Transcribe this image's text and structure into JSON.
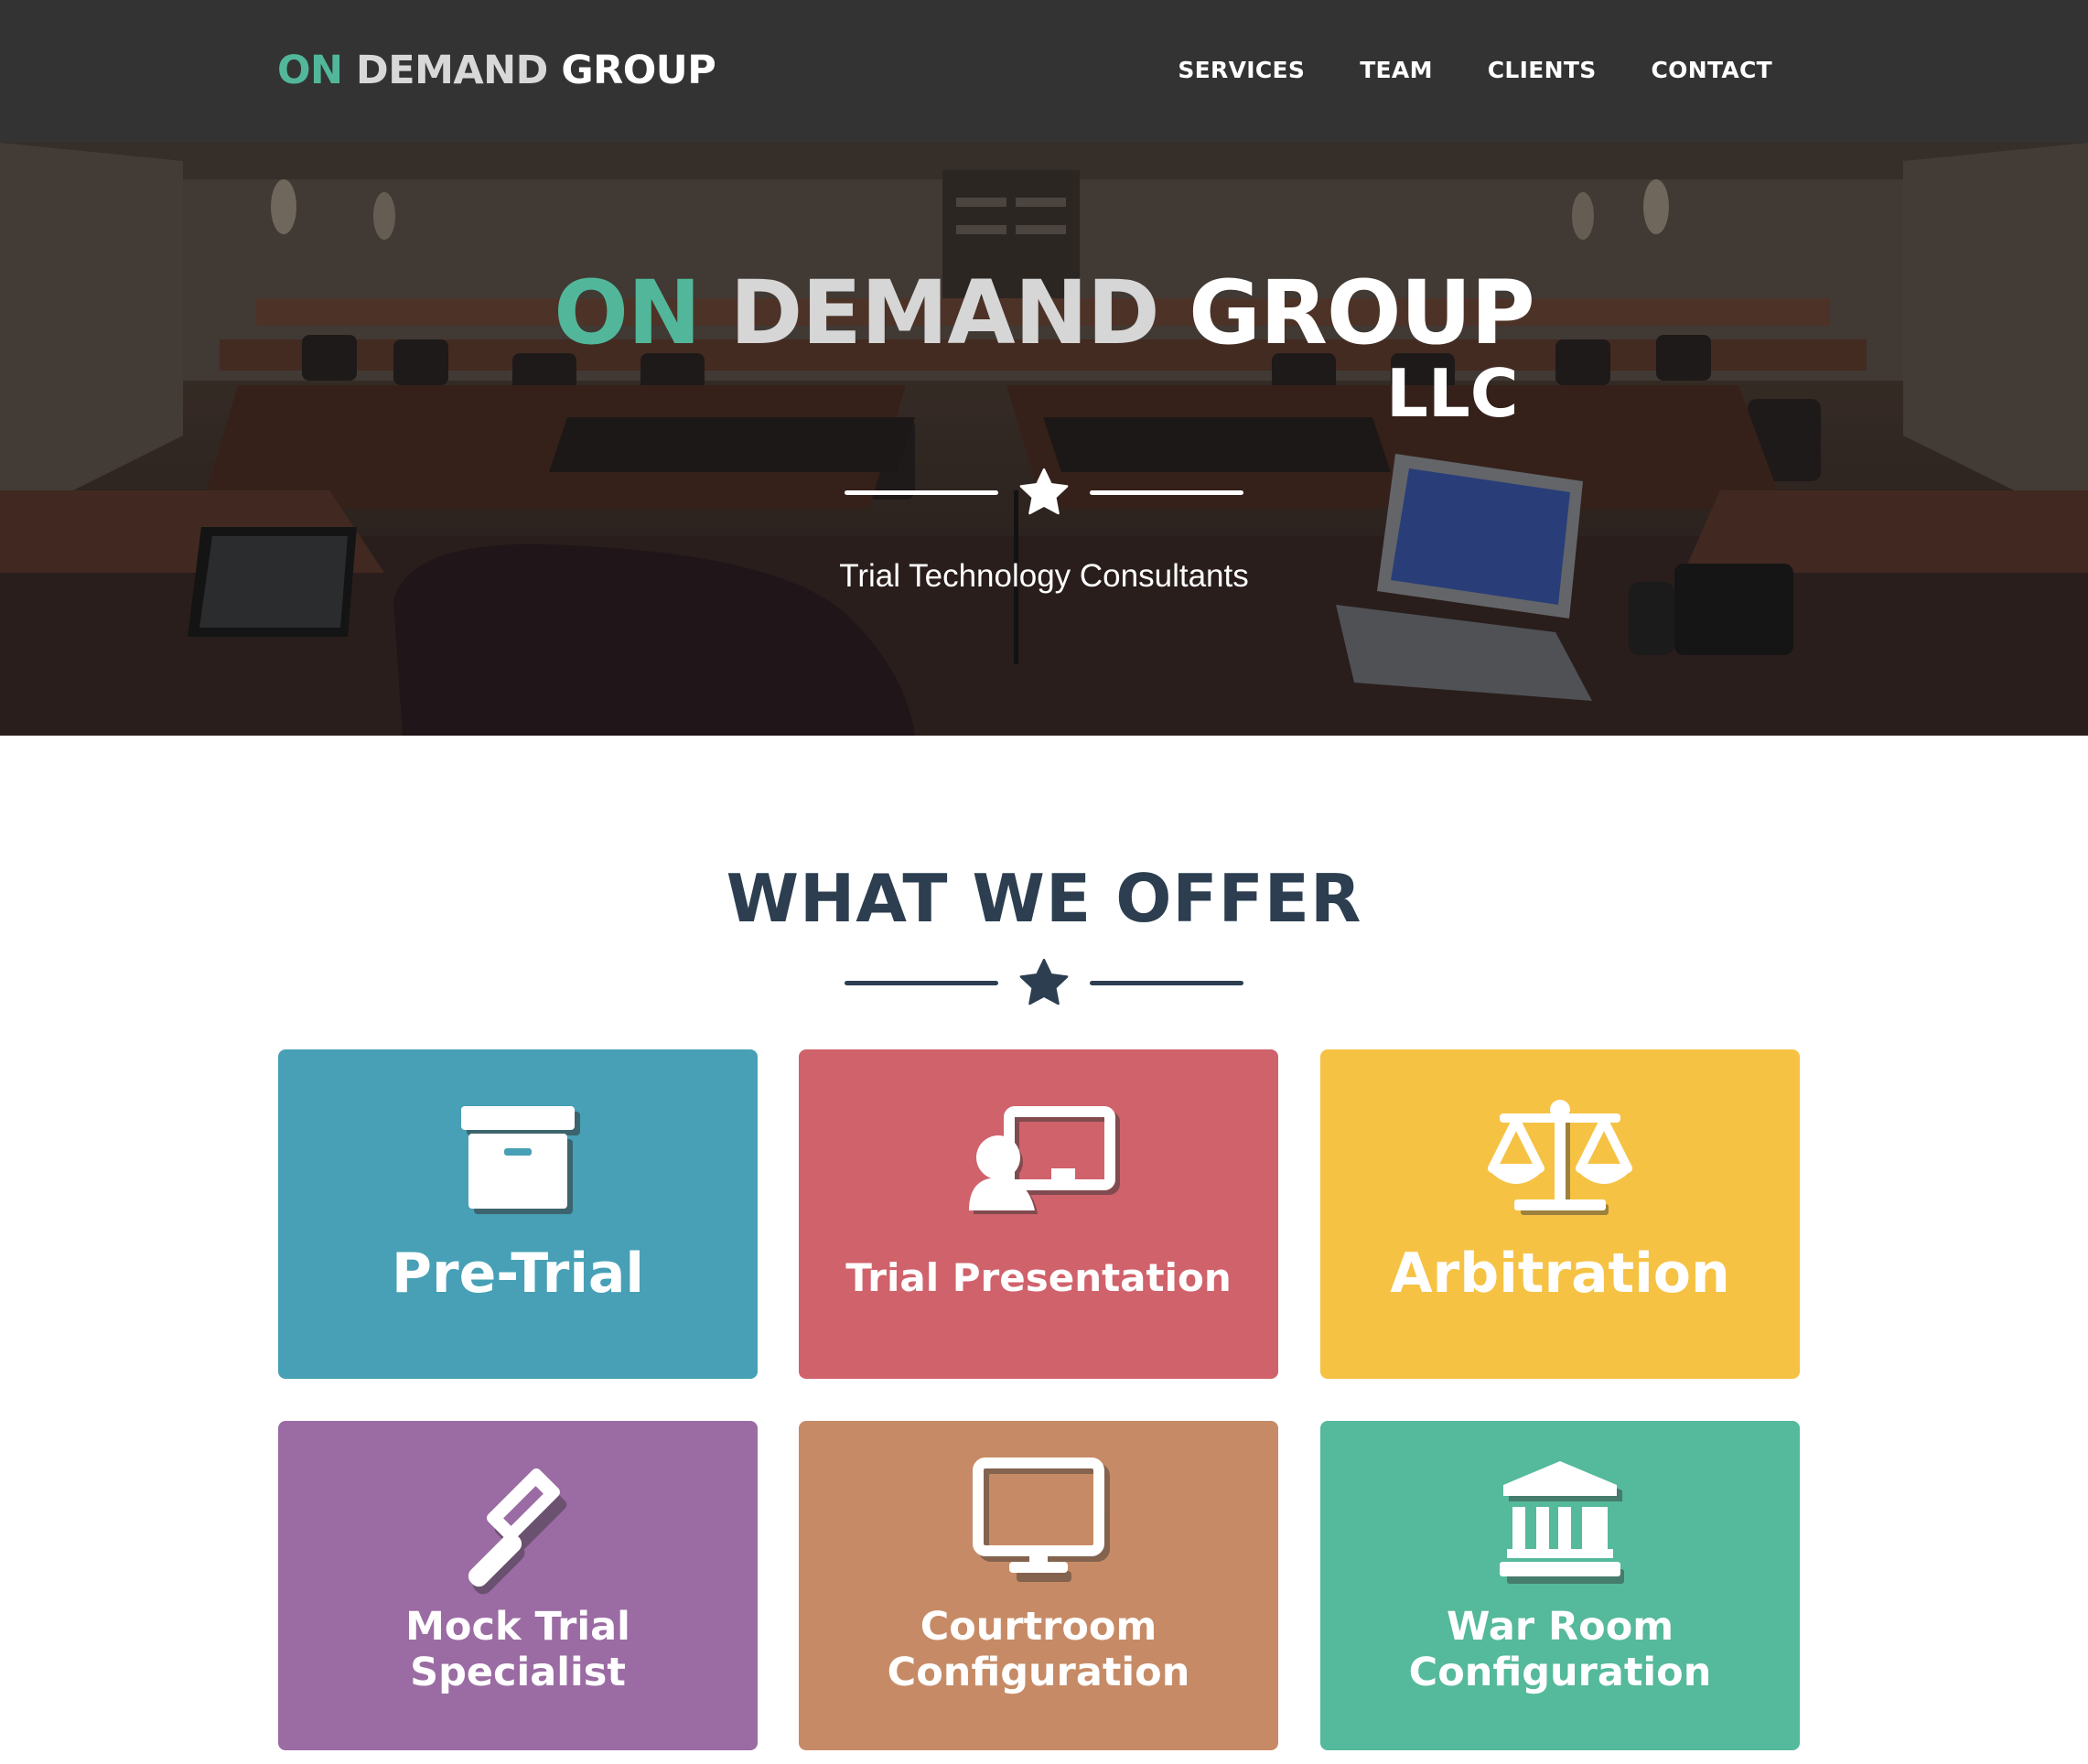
{
  "nav": {
    "logo": {
      "part1": "ON",
      "part2": "DEMAND",
      "part3": "GROUP"
    },
    "links": [
      "SERVICES",
      "TEAM",
      "CLIENTS",
      "CONTACT"
    ]
  },
  "hero": {
    "title": {
      "part1": "ON",
      "part2": "DEMAND",
      "part3": "GROUP"
    },
    "suffix": "LLC",
    "divider_icon": "star-icon",
    "subtitle": "Trial Technology Consultants",
    "background": "courtroom-photo"
  },
  "offer": {
    "heading": "WHAT WE OFFER",
    "divider_icon": "star-icon",
    "cards": [
      {
        "label": "Pre-Trial",
        "icon": "archive-box-icon",
        "color": "#47a0b6"
      },
      {
        "label": "Trial Presentation",
        "icon": "presenter-board-icon",
        "color": "#d0626b"
      },
      {
        "label": "Arbitration",
        "icon": "balance-scale-icon",
        "color": "#f6c244"
      },
      {
        "label_line1": "Mock Trial",
        "label_line2": "Specialist",
        "icon": "gavel-icon",
        "color": "#9b6ba3"
      },
      {
        "label_line1": "Courtroom",
        "label_line2": "Configuration",
        "icon": "monitor-icon",
        "color": "#c68b66"
      },
      {
        "label_line1": "War Room",
        "label_line2": "Configuration",
        "icon": "bank-building-icon",
        "color": "#55b99b"
      }
    ]
  },
  "colors": {
    "navbar": "#333333",
    "accent_green": "#52b79a",
    "heading_navy": "#2c3e50"
  }
}
